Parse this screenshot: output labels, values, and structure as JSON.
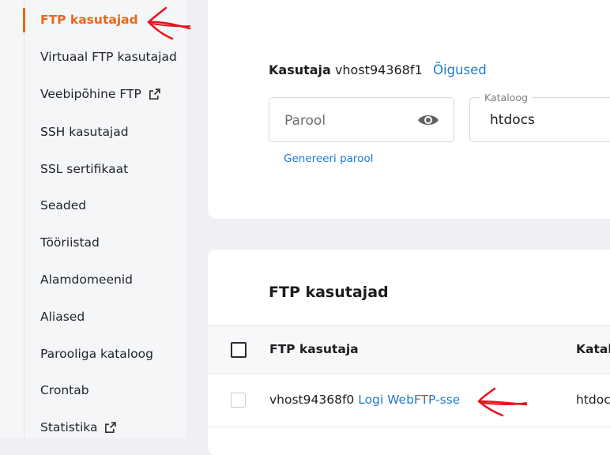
{
  "sidebar": {
    "items": [
      {
        "label": "FTP kasutajad",
        "active": true
      },
      {
        "label": "Virtuaal FTP kasutajad"
      },
      {
        "label": "Veebipõhine FTP",
        "icon": "external-link-icon"
      },
      {
        "label": "SSH kasutajad"
      },
      {
        "label": "SSL sertifikaat"
      },
      {
        "label": "Seaded"
      },
      {
        "label": "Tööriistad"
      },
      {
        "label": "Alamdomeenid"
      },
      {
        "label": "Aliased"
      },
      {
        "label": "Parooliga kataloog"
      },
      {
        "label": "Crontab"
      },
      {
        "label": "Statistika",
        "icon": "external-link-icon"
      }
    ]
  },
  "user_form": {
    "user_key": "Kasutaja",
    "user_value": "vhost94368f1",
    "rights_link": "Õigused",
    "password_placeholder": "Parool",
    "directory_label": "Kataloog",
    "directory_value": "htdocs",
    "generate_link": "Genereeri parool"
  },
  "ftp_table": {
    "title": "FTP kasutajad",
    "columns": [
      "FTP kasutaja",
      "Katalo"
    ],
    "rows": [
      {
        "user": "vhost94368f0",
        "link": "Logi WebFTP-sse",
        "directory": "htdoc"
      }
    ]
  },
  "colors": {
    "accent": "#e8671a",
    "link": "#1e7ad1",
    "annotation": "#e8141c"
  }
}
